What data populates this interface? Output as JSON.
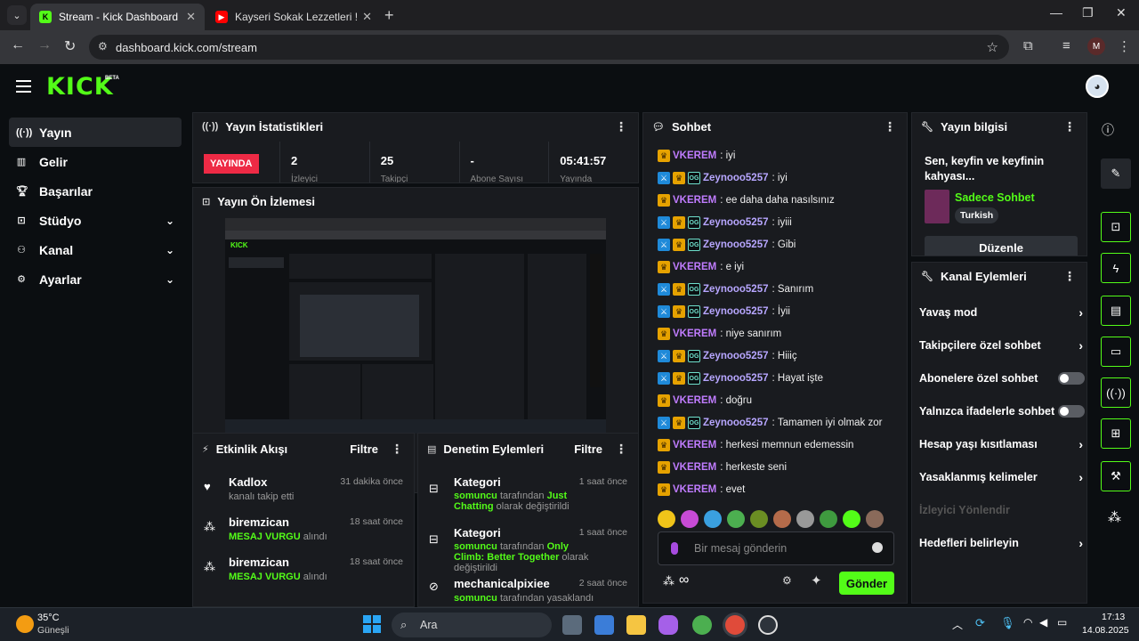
{
  "browser": {
    "tabs": [
      {
        "title": "Stream - Kick Dashboard",
        "favicon": "K",
        "active": true
      },
      {
        "title": "Kayseri Sokak Lezzetleri ! Delle",
        "favicon": "▶",
        "active": false
      }
    ],
    "url": "dashboard.kick.com/stream",
    "profile_initial": "M"
  },
  "header": {
    "logo": "KICK",
    "badge": "BETA"
  },
  "sidebar": {
    "items": [
      {
        "label": "Yayın",
        "icon": "broadcast-icon"
      },
      {
        "label": "Gelir",
        "icon": "chart-icon"
      },
      {
        "label": "Başarılar",
        "icon": "trophy-icon"
      },
      {
        "label": "Stüdyo",
        "icon": "studio-icon"
      },
      {
        "label": "Kanal",
        "icon": "users-icon"
      },
      {
        "label": "Ayarlar",
        "icon": "gear-icon"
      }
    ]
  },
  "stats": {
    "title": "Yayın İstatistikleri",
    "live": "YAYINDA",
    "cells": [
      {
        "value": "2",
        "label": "İzleyici"
      },
      {
        "value": "25",
        "label": "Takipçi"
      },
      {
        "value": "-",
        "label": "Abone Sayısı"
      },
      {
        "value": "05:41:57",
        "label": "Yayında"
      }
    ]
  },
  "preview": {
    "title": "Yayın Ön İzlemesi"
  },
  "activity": {
    "title": "Etkinlik Akışı",
    "filter": "Filtre",
    "items": [
      {
        "name": "Kadlox",
        "sub": "kanalı takip etti",
        "highlight": "",
        "time": "31 dakika önce"
      },
      {
        "name": "biremzican",
        "sub": "alındı",
        "highlight": "MESAJ VURGU",
        "time": "18 saat önce"
      },
      {
        "name": "biremzican",
        "sub": "alındı",
        "highlight": "MESAJ VURGU",
        "time": "18 saat önce"
      }
    ]
  },
  "moderation": {
    "title": "Denetim Eylemleri",
    "filter": "Filtre",
    "items": [
      {
        "name": "Kategori",
        "time": "1 saat önce",
        "actor": "somuncu",
        "mid": "tarafından",
        "target": "Just Chatting",
        "tail": "olarak değiştirildi"
      },
      {
        "name": "Kategori",
        "time": "1 saat önce",
        "actor": "somuncu",
        "mid": "tarafından",
        "target": "Only Climb: Better Together",
        "tail": "olarak değiştirildi"
      },
      {
        "name": "mechanicalpixiee",
        "time": "2 saat önce",
        "actor": "somuncu",
        "mid": "tarafından yasaklandı",
        "target": "",
        "tail": ""
      }
    ]
  },
  "chat": {
    "title": "Sohbet",
    "messages": [
      {
        "user": "VKEREM",
        "text": "iyi",
        "color": "#c07cff",
        "mod": false
      },
      {
        "user": "Zeynooo5257",
        "text": "iyi",
        "color": "#b7a6ff",
        "mod": true
      },
      {
        "user": "VKEREM",
        "text": "ee daha daha nasılsınız",
        "color": "#c07cff",
        "mod": false
      },
      {
        "user": "Zeynooo5257",
        "text": "iyiii",
        "color": "#b7a6ff",
        "mod": true
      },
      {
        "user": "Zeynooo5257",
        "text": "Gibi",
        "color": "#b7a6ff",
        "mod": true
      },
      {
        "user": "VKEREM",
        "text": "e iyi",
        "color": "#c07cff",
        "mod": false
      },
      {
        "user": "Zeynooo5257",
        "text": "Sanırım",
        "color": "#b7a6ff",
        "mod": true
      },
      {
        "user": "Zeynooo5257",
        "text": "İyii",
        "color": "#b7a6ff",
        "mod": true
      },
      {
        "user": "VKEREM",
        "text": "niye sanırım",
        "color": "#c07cff",
        "mod": false
      },
      {
        "user": "Zeynooo5257",
        "text": "Hiiiç",
        "color": "#b7a6ff",
        "mod": true
      },
      {
        "user": "Zeynooo5257",
        "text": "Hayat işte",
        "color": "#b7a6ff",
        "mod": true
      },
      {
        "user": "VKEREM",
        "text": "doğru",
        "color": "#c07cff",
        "mod": false
      },
      {
        "user": "Zeynooo5257",
        "text": "Tamamen iyi olmak zor",
        "color": "#b7a6ff",
        "mod": true
      },
      {
        "user": "VKEREM",
        "text": "herkesi memnun edemessin",
        "color": "#c07cff",
        "mod": false
      },
      {
        "user": "VKEREM",
        "text": "herkeste seni",
        "color": "#c07cff",
        "mod": false
      },
      {
        "user": "VKEREM",
        "text": "evet",
        "color": "#c07cff",
        "mod": false
      }
    ],
    "emotes": [
      "#f0c419",
      "#c84bd6",
      "#3aa0e0",
      "#4caf50",
      "#6b8e23",
      "#b56b4a",
      "#999999",
      "#3f9b3f",
      "#53fc18",
      "#8a6a5a"
    ],
    "placeholder": "Bir mesaj gönderin",
    "send": "Gönder",
    "infinity": "∞"
  },
  "stream_info": {
    "title": "Yayın bilgisi",
    "stream_title": "Sen, keyfin ve keyfinin kahyası...",
    "category": "Sadece Sohbet",
    "language": "Turkish",
    "edit": "Düzenle"
  },
  "channel_actions": {
    "title": "Kanal Eylemleri",
    "items": [
      {
        "label": "Yavaş mod",
        "type": "arrow"
      },
      {
        "label": "Takipçilere özel sohbet",
        "type": "arrow"
      },
      {
        "label": "Abonelere özel sohbet",
        "type": "toggle"
      },
      {
        "label": "Yalnızca ifadelerle sohbet",
        "type": "toggle"
      },
      {
        "label": "Hesap yaşı kısıtlaması",
        "type": "arrow"
      },
      {
        "label": "Yasaklanmış kelimeler",
        "type": "arrow"
      },
      {
        "label": "İzleyici Yönlendir",
        "type": "disabled"
      },
      {
        "label": "Hedefleri belirleyin",
        "type": "arrow"
      }
    ]
  },
  "right_rail": [
    "info-icon",
    "pencil-icon",
    "stream-preview-icon",
    "lightning-icon",
    "document-icon",
    "chat-icon",
    "broadcast-icon",
    "layout-icon",
    "wrench-icon",
    "dots-icon"
  ],
  "taskbar": {
    "weather_temp": "35°C",
    "weather_desc": "Güneşli",
    "search": "Ara",
    "time": "17:13",
    "date": "14.08.2025"
  }
}
